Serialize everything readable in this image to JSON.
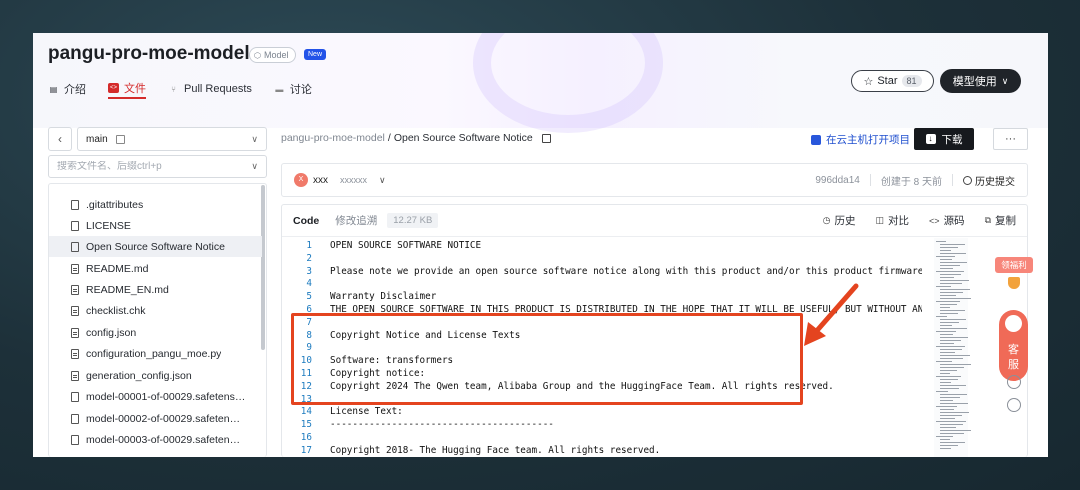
{
  "repo": {
    "title": "pangu-pro-moe-model",
    "type_badge": "Model",
    "new_badge": "New"
  },
  "tabs": [
    {
      "label": "介绍",
      "icon": "book-icon"
    },
    {
      "label": "文件",
      "icon": "code-file-icon"
    },
    {
      "label": "Pull Requests",
      "icon": "pull-request-icon"
    },
    {
      "label": "讨论",
      "icon": "chat-icon"
    }
  ],
  "actions": {
    "star_label": "Star",
    "star_count": "81",
    "model_use_label": "模型使用"
  },
  "branch": {
    "name": "main"
  },
  "search": {
    "placeholder": "搜索文件名、后缀ctrl+p"
  },
  "files": [
    ".gitattributes",
    "LICENSE",
    "Open Source Software Notice",
    "README.md",
    "README_EN.md",
    "checklist.chk",
    "config.json",
    "configuration_pangu_moe.py",
    "generation_config.json",
    "model-00001-of-00029.safetens…",
    "model-00002-of-00029.safeten…",
    "model-00003-of-00029.safeten…"
  ],
  "breadcrumb": {
    "root": "pangu-pro-moe-model",
    "sep": "/",
    "current": "Open Source Software Notice"
  },
  "toolbar": {
    "open_cloud_label": "在云主机打开项目",
    "download_label": "下载",
    "more_label": "···"
  },
  "commit": {
    "avatar_letter": "X",
    "author": "xxx",
    "message": "xxxxxx",
    "hash": "996dda14",
    "created": "创建于 8 天前",
    "history_label": "历史提交"
  },
  "code": {
    "tab_code": "Code",
    "tab_blame": "修改追溯",
    "size": "12.27 KB",
    "action_history": "历史",
    "action_compare": "对比",
    "action_source": "源码",
    "action_copy": "复制",
    "lines": [
      "OPEN SOURCE SOFTWARE NOTICE",
      "",
      "Please note we provide an open source software notice along with this product and/or this product firmware (in the fo",
      "",
      "Warranty Disclaimer",
      "THE OPEN SOURCE SOFTWARE IN THIS PRODUCT IS DISTRIBUTED IN THE HOPE THAT IT WILL BE USEFUL, BUT WITHOUT ANY WARRANTY,",
      "",
      "Copyright Notice and License Texts",
      "",
      "Software: transformers",
      "Copyright notice:",
      "Copyright 2024 The Qwen team, Alibaba Group and the HuggingFace Team. All rights reserved.",
      "",
      "License Text:",
      "----------------------------------------",
      "",
      "Copyright 2018- The Hugging Face team. All rights reserved."
    ]
  },
  "floating": {
    "welfare_label": "领福利",
    "service_label_1": "客",
    "service_label_2": "服"
  },
  "colors": {
    "accent_red": "#d42b2b",
    "highlight_orange": "#e4441f",
    "link_blue": "#1f4fcf"
  }
}
